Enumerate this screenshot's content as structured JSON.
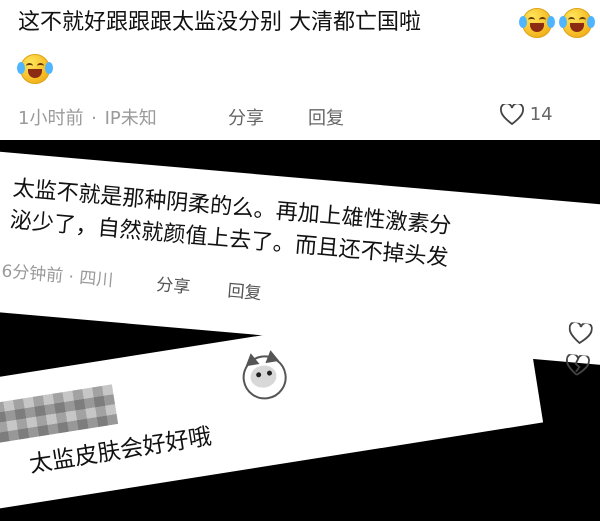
{
  "comment1": {
    "text": "这不就好跟跟跟太监没分别 大清都亡国啦",
    "time": "1小时前",
    "location": "IP未知",
    "share": "分享",
    "reply": "回复",
    "likes": "14",
    "emoji": "laughing-crying-emoji"
  },
  "comment2": {
    "line1": "太监不就是那种阴柔的么。再加上雄性激素分",
    "line2": "泌少了，自然就颜值上去了。而且还不掉头发",
    "time": "6分钟前",
    "location": "四川",
    "share": "分享",
    "reply": "回复"
  },
  "comment3": {
    "text": "太监皮肤会好好哦",
    "emoji": "doge-emoji"
  }
}
